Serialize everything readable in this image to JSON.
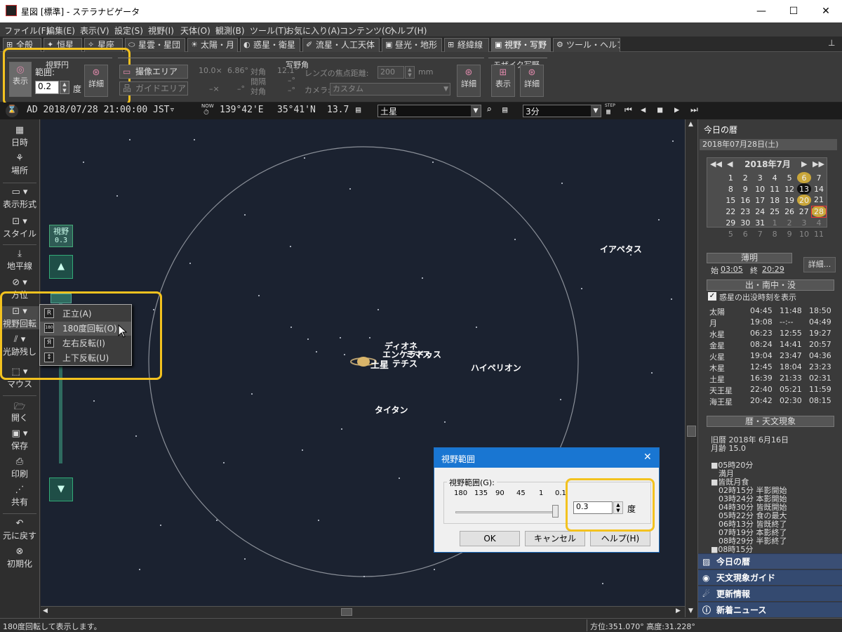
{
  "window": {
    "title": "星図 [標準] - ステラナビゲータ",
    "min": "—",
    "max": "☐",
    "close": "✕"
  },
  "menu": [
    "ファイル(F)",
    "編集(E)",
    "表示(V)",
    "設定(S)",
    "視野(I)",
    "天体(O)",
    "観測(B)",
    "ツール(T)",
    "お気に入り(A)",
    "コンテンツ(C)",
    "ヘルプ(H)"
  ],
  "tabs": [
    "全般",
    "恒星",
    "星座",
    "星雲・星団",
    "太陽・月",
    "惑星・衛星",
    "流星・人工天体",
    "昼光・地形",
    "経緯線",
    "視野・写野",
    "ツール・ヘルプ"
  ],
  "tab_icons": [
    "⊞",
    "✦",
    "✧",
    "⬭",
    "☀",
    "◐",
    "✐",
    "▣",
    "⊞",
    "▣",
    "⚙"
  ],
  "ribbon": {
    "grp1": "視野円",
    "show": "表示",
    "range_label": "範囲:",
    "range_value": "0.2",
    "deg": "度",
    "detail": "詳細",
    "grp2": "写野角",
    "area_btn": "撮像エリア",
    "guide_btn": "ガイドエリア",
    "fov_w": "10.0×",
    "fov_h": "6.86°",
    "diag1": "対角",
    "gap": "間隔",
    "diag2": "対角",
    "fov_d": "12.1°",
    "dash1": "–×",
    "dash2": "–°",
    "dash3": "–°",
    "dash4": "–°",
    "lens_label": "レンズの焦点距離:",
    "lens_value": "200",
    "mm": "mm",
    "camera_label": "カメラ:",
    "camera_value": "カスタム",
    "detail2": "詳細",
    "grp3": "モザイク写野",
    "show2": "表示",
    "detail3": "詳細"
  },
  "infobar": {
    "datetime": "AD 2018/07/28 21:00:00 JST▿",
    "now": "NOW",
    "lon": "139°42'E",
    "lat": "35°41'N",
    "val": "13.7",
    "target": "土星",
    "step": "3分",
    "step_label": "STEP"
  },
  "leftbar": {
    "items": [
      "日時",
      "場所",
      "表示形式",
      "スタイル",
      "地平線",
      "方位",
      "視野回転",
      "光跡残し",
      "マウス",
      "開く",
      "保存",
      "印刷",
      "共有",
      "元に戻す",
      "初期化"
    ],
    "fov_label": "視野",
    "fov_value": "0.3"
  },
  "context_menu": [
    {
      "icon": "R",
      "label": "正立(A)"
    },
    {
      "icon": "180",
      "label": "180度回転(O)"
    },
    {
      "icon": "Я",
      "label": "左右反転(I)"
    },
    {
      "icon": "↕",
      "label": "上下反転(U)"
    }
  ],
  "sky_labels": [
    "イアペタス",
    "ディオネ",
    "エンケラドゥス",
    "ミマス",
    "テチス",
    "土星",
    "ハイペリオン",
    "タイタン"
  ],
  "dialog": {
    "title": "視野範囲",
    "group": "視野範囲(G):",
    "ticks": [
      "180",
      "135",
      "90",
      "45",
      "1",
      "0.1"
    ],
    "value": "0.3",
    "deg": "度",
    "ok": "OK",
    "cancel": "キャンセル",
    "help": "ヘルプ(H)"
  },
  "rightpanel": {
    "header": "今日の暦",
    "date": "2018年07月28日(土)",
    "month": "2018年7月",
    "calendar": [
      [
        "",
        "1",
        "2",
        "3",
        "4",
        "5",
        "6",
        "7"
      ],
      [
        "",
        "8",
        "9",
        "10",
        "11",
        "12",
        "13",
        "14"
      ],
      [
        "",
        "15",
        "16",
        "17",
        "18",
        "19",
        "20",
        "21"
      ],
      [
        "",
        "22",
        "23",
        "24",
        "25",
        "26",
        "27",
        "28"
      ],
      [
        "",
        "29",
        "30",
        "31",
        "1",
        "2",
        "3",
        "4"
      ],
      [
        "",
        "5",
        "6",
        "7",
        "8",
        "9",
        "10",
        "11"
      ]
    ],
    "twilight": "薄明",
    "start_label": "始",
    "start": "03:05",
    "end_label": "終",
    "end": "20:29",
    "detail": "詳細...",
    "rise_header": "出・南中・没",
    "check_label": "惑星の出没時刻を表示",
    "rise": [
      [
        "太陽",
        "04:45",
        "11:48",
        "18:50"
      ],
      [
        "月",
        "19:08",
        "--:--",
        "04:49"
      ],
      [
        "水星",
        "06:23",
        "12:55",
        "19:27"
      ],
      [
        "金星",
        "08:24",
        "14:41",
        "20:57"
      ],
      [
        "火星",
        "19:04",
        "23:47",
        "04:36"
      ],
      [
        "木星",
        "12:45",
        "18:04",
        "23:23"
      ],
      [
        "土星",
        "16:39",
        "21:33",
        "02:31"
      ],
      [
        "天王星",
        "22:40",
        "05:21",
        "11:59"
      ],
      [
        "海王星",
        "20:42",
        "02:30",
        "08:15"
      ]
    ],
    "events_header": "暦・天文現象",
    "events": [
      "旧暦 2018年 6月16日",
      "月齢 15.0",
      "",
      "■05時20分",
      "　満月",
      "■皆既月食",
      "　02時15分 半影開始",
      "　03時24分 本影開始",
      "　04時30分 皆既開始",
      "　05時22分 食の最大",
      "　06時13分 皆既終了",
      "　07時19分 本影終了",
      "　08時29分 半影終了",
      "■08時15分"
    ],
    "ptabs": [
      "今日の暦",
      "天文現象ガイド",
      "更新情報",
      "新着ニュース"
    ]
  },
  "status": {
    "left": "180度回転して表示します。",
    "right": "方位:351.070°  高度:31.228°"
  },
  "colors": {
    "highlight": "#f3c21f",
    "sky": "#1b2230",
    "dialog_title": "#1976d2"
  }
}
